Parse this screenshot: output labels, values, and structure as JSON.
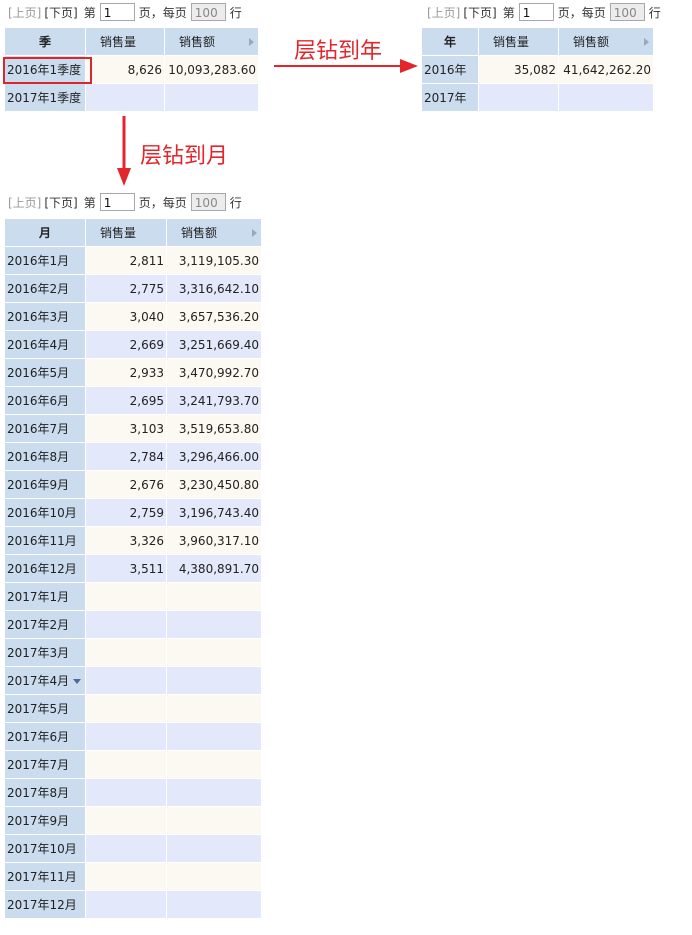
{
  "pager": {
    "prev": "[上页]",
    "next": "[下页]",
    "page_prefix": "第",
    "page_value": "1",
    "page_suffix": "页，",
    "size_prefix": "每页",
    "size_value": "100",
    "size_suffix": "行"
  },
  "quarter_table": {
    "columns": [
      "季",
      "销售量",
      "销售额"
    ],
    "rows": [
      {
        "label": "2016年1季度",
        "qty": "8,626",
        "amount": "10,093,283.60"
      },
      {
        "label": "2017年1季度",
        "qty": "",
        "amount": ""
      }
    ]
  },
  "year_table": {
    "columns": [
      "年",
      "销售量",
      "销售额"
    ],
    "rows": [
      {
        "label": "2016年",
        "qty": "35,082",
        "amount": "41,642,262.20"
      },
      {
        "label": "2017年",
        "qty": "",
        "amount": ""
      }
    ]
  },
  "month_table": {
    "columns": [
      "月",
      "销售量",
      "销售额"
    ],
    "rows": [
      {
        "label": "2016年1月",
        "qty": "2,811",
        "amount": "3,119,105.30"
      },
      {
        "label": "2016年2月",
        "qty": "2,775",
        "amount": "3,316,642.10"
      },
      {
        "label": "2016年3月",
        "qty": "3,040",
        "amount": "3,657,536.20"
      },
      {
        "label": "2016年4月",
        "qty": "2,669",
        "amount": "3,251,669.40"
      },
      {
        "label": "2016年5月",
        "qty": "2,933",
        "amount": "3,470,992.70"
      },
      {
        "label": "2016年6月",
        "qty": "2,695",
        "amount": "3,241,793.70"
      },
      {
        "label": "2016年7月",
        "qty": "3,103",
        "amount": "3,519,653.80"
      },
      {
        "label": "2016年8月",
        "qty": "2,784",
        "amount": "3,296,466.00"
      },
      {
        "label": "2016年9月",
        "qty": "2,676",
        "amount": "3,230,450.80"
      },
      {
        "label": "2016年10月",
        "qty": "2,759",
        "amount": "3,196,743.40"
      },
      {
        "label": "2016年11月",
        "qty": "3,326",
        "amount": "3,960,317.10"
      },
      {
        "label": "2016年12月",
        "qty": "3,511",
        "amount": "4,380,891.70"
      },
      {
        "label": "2017年1月",
        "qty": "",
        "amount": ""
      },
      {
        "label": "2017年2月",
        "qty": "",
        "amount": ""
      },
      {
        "label": "2017年3月",
        "qty": "",
        "amount": ""
      },
      {
        "label": "2017年4月",
        "qty": "",
        "amount": ""
      },
      {
        "label": "2017年5月",
        "qty": "",
        "amount": ""
      },
      {
        "label": "2017年6月",
        "qty": "",
        "amount": ""
      },
      {
        "label": "2017年7月",
        "qty": "",
        "amount": ""
      },
      {
        "label": "2017年8月",
        "qty": "",
        "amount": ""
      },
      {
        "label": "2017年9月",
        "qty": "",
        "amount": ""
      },
      {
        "label": "2017年10月",
        "qty": "",
        "amount": ""
      },
      {
        "label": "2017年11月",
        "qty": "",
        "amount": ""
      },
      {
        "label": "2017年12月",
        "qty": "",
        "amount": ""
      }
    ]
  },
  "annotations": {
    "drill_year": "层钻到年",
    "drill_month": "层钻到月"
  },
  "colors": {
    "header_bg": "#cbdcef",
    "row_odd": "#fbf9f1",
    "row_even": "#e3e8fa",
    "accent_red": "#e2262b"
  },
  "icons": {
    "arrow_right": "arrow-right-icon",
    "arrow_down": "arrow-down-icon",
    "sort": "sort-down-icon"
  }
}
